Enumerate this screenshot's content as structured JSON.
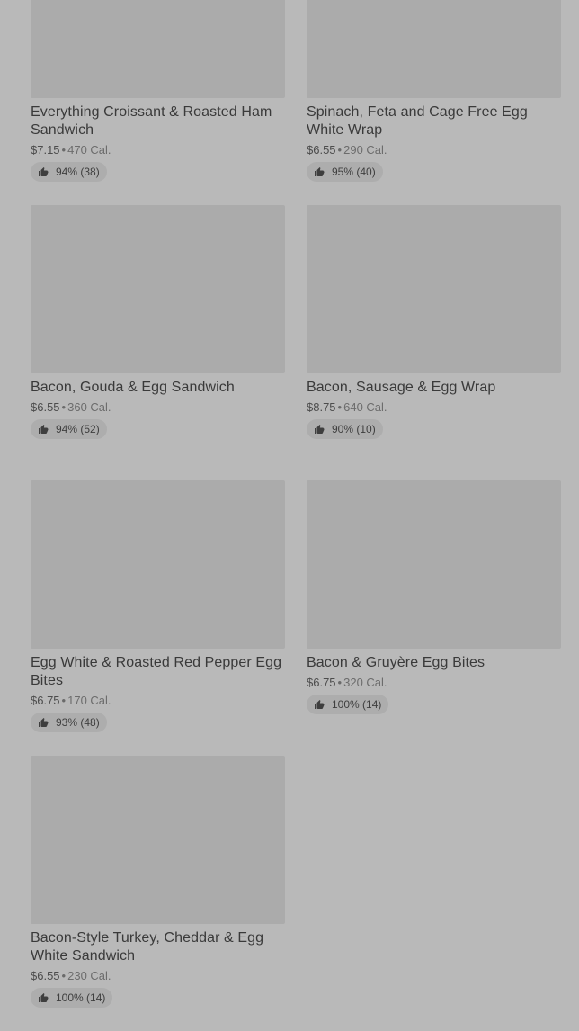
{
  "colors": {
    "background": "#b9b9b9",
    "placeholder": "#ababab",
    "rating_pill": "#adadad",
    "text": "#3a3a3a"
  },
  "menu": {
    "items": [
      {
        "name": "Everything Croissant & Roasted Ham Sandwich",
        "price": "$7.15",
        "calories": "470 Cal.",
        "rating": "94% (38)",
        "icon": "thumbs-up-icon"
      },
      {
        "name": "Spinach, Feta and Cage Free Egg White Wrap",
        "price": "$6.55",
        "calories": "290 Cal.",
        "rating": "95% (40)",
        "icon": "thumbs-up-icon"
      },
      {
        "name": "Bacon, Gouda & Egg Sandwich",
        "price": "$6.55",
        "calories": "360 Cal.",
        "rating": "94% (52)",
        "icon": "thumbs-up-icon"
      },
      {
        "name": "Bacon, Sausage & Egg Wrap",
        "price": "$8.75",
        "calories": "640 Cal.",
        "rating": "90% (10)",
        "icon": "thumbs-up-icon"
      },
      {
        "name": "Egg White & Roasted Red Pepper Egg Bites",
        "price": "$6.75",
        "calories": "170 Cal.",
        "rating": "93% (48)",
        "icon": "thumbs-up-icon"
      },
      {
        "name": "Bacon & Gruyère Egg Bites",
        "price": "$6.75",
        "calories": "320 Cal.",
        "rating": "100% (14)",
        "icon": "thumbs-up-icon"
      },
      {
        "name": "Bacon-Style Turkey, Cheddar & Egg White Sandwich",
        "price": "$6.55",
        "calories": "230 Cal.",
        "rating": "100% (14)",
        "icon": "thumbs-up-icon"
      }
    ]
  }
}
